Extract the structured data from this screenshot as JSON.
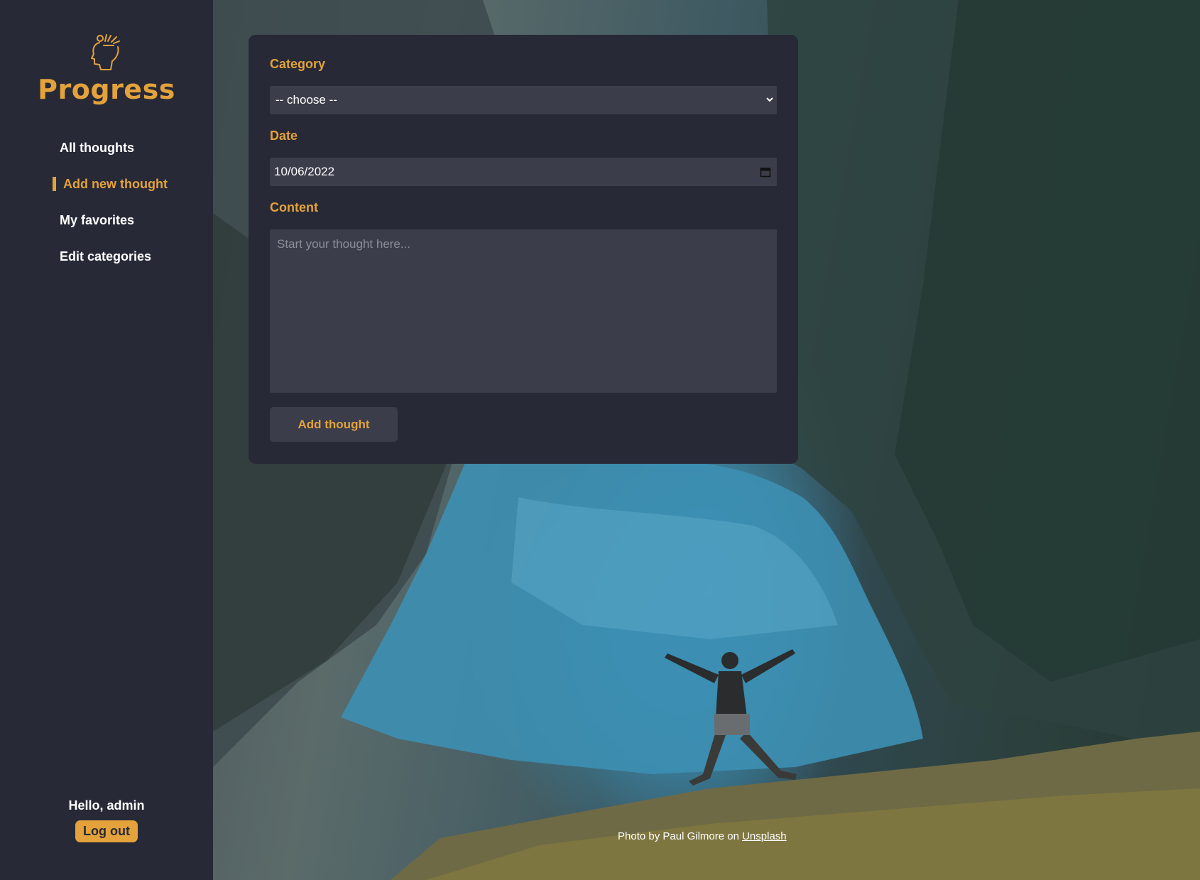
{
  "app": {
    "brand": "Progress",
    "accent_color": "#e3a23b",
    "sidebar_color": "#272936"
  },
  "sidebar": {
    "items": [
      {
        "label": "All thoughts",
        "active": false
      },
      {
        "label": "Add new thought",
        "active": true
      },
      {
        "label": "My favorites",
        "active": false
      },
      {
        "label": "Edit categories",
        "active": false
      }
    ],
    "greeting": "Hello, admin",
    "logout_label": "Log out"
  },
  "form": {
    "category_label": "Category",
    "category_value": "-- choose --",
    "date_label": "Date",
    "date_value": "10/06/2022",
    "content_label": "Content",
    "content_placeholder": "Start your thought here...",
    "submit_label": "Add thought"
  },
  "credit": {
    "prefix": "Photo by Paul Gilmore on ",
    "link_text": "Unsplash"
  },
  "icons": {
    "logo": "head-with-ideas-icon",
    "select": "chevron-down-icon",
    "date": "calendar-icon"
  }
}
